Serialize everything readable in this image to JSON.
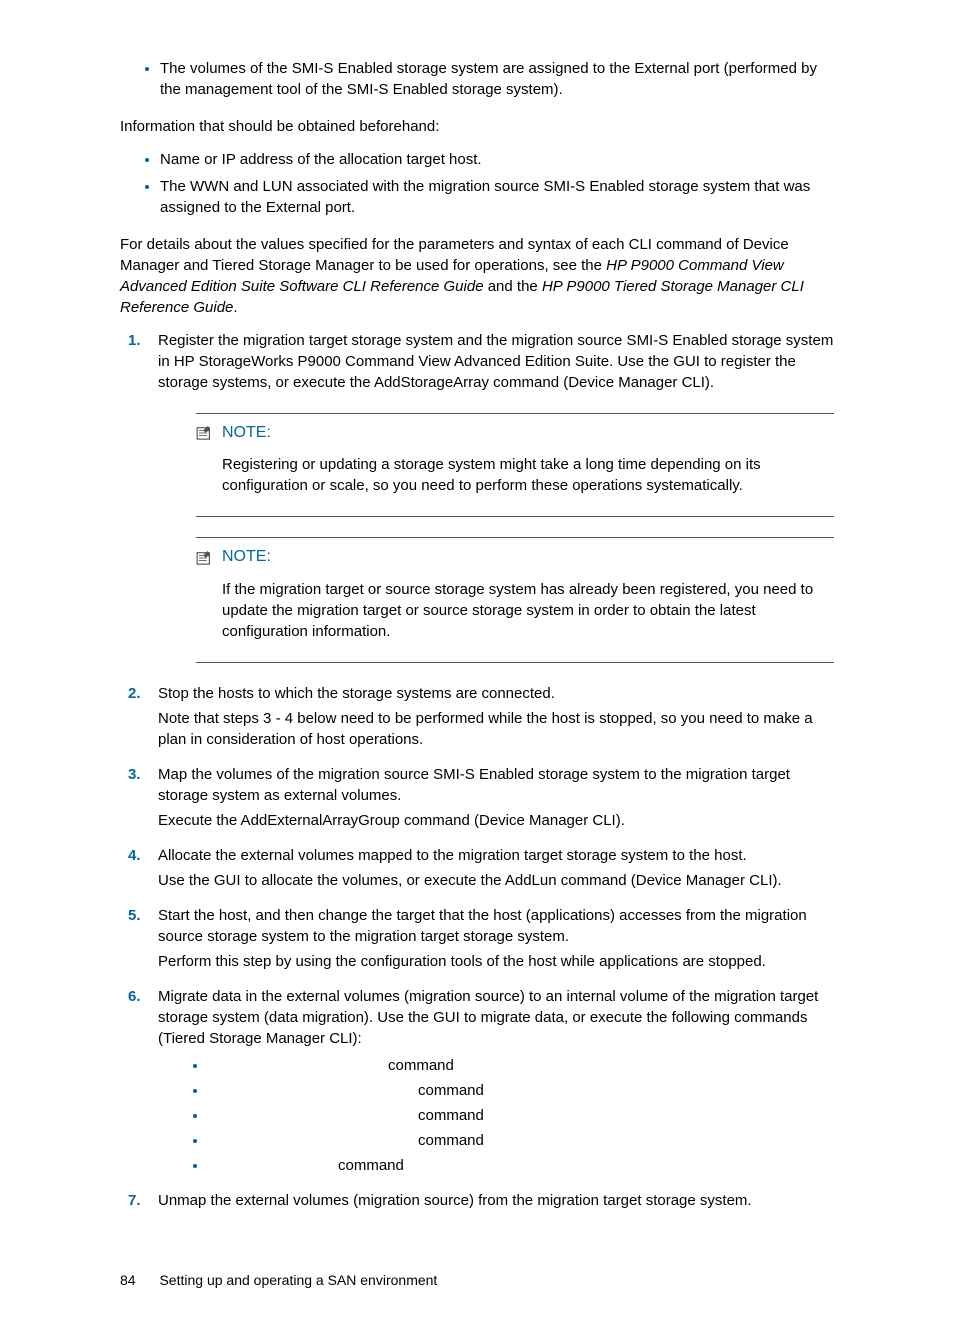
{
  "top_bullets": [
    "The volumes of the SMI-S Enabled storage system are assigned to the External port (performed by the management tool of the SMI-S Enabled storage system)."
  ],
  "info_intro": "Information that should be obtained beforehand:",
  "info_bullets": [
    "Name or IP address of the allocation target host.",
    "The WWN and LUN associated with the migration source SMI-S Enabled storage system that was assigned to the External port."
  ],
  "details_para_1": "For details about the values specified for the parameters and syntax of each CLI command of Device Manager and Tiered Storage Manager to be used for operations, see the ",
  "details_italic_1": "HP P9000 Command View Advanced Edition Suite Software CLI Reference Guide",
  "details_para_2": " and the ",
  "details_italic_2": "HP P9000 Tiered Storage Manager CLI Reference Guide",
  "details_para_3": ".",
  "steps": {
    "1": {
      "num": "1.",
      "text": "Register the migration target storage system and the migration source SMI-S Enabled storage system in HP StorageWorks P9000 Command View Advanced Edition Suite. Use the GUI to register the storage systems, or execute the AddStorageArray command (Device Manager CLI)."
    },
    "2": {
      "num": "2.",
      "text": "Stop the hosts to which the storage systems are connected.",
      "extra": "Note that steps 3 - 4 below need to be performed while the host is stopped, so you need to make a plan in consideration of host operations."
    },
    "3": {
      "num": "3.",
      "text": "Map the volumes of the migration source SMI-S Enabled storage system to the migration target storage system as external volumes.",
      "extra": "Execute the AddExternalArrayGroup command (Device Manager CLI)."
    },
    "4": {
      "num": "4.",
      "text": "Allocate the external volumes mapped to the migration target storage system to the host.",
      "extra": "Use the GUI to allocate the volumes, or execute the AddLun command (Device Manager CLI)."
    },
    "5": {
      "num": "5.",
      "text": "Start the host, and then change the target that the host (applications) accesses from the migration source storage system to the migration target storage system.",
      "extra": "Perform this step by using the configuration tools of the host while applications are stopped."
    },
    "6": {
      "num": "6.",
      "text": "Migrate data in the external volumes (migration source) to an internal volume of the migration target storage system (data migration). Use the GUI to migrate data, or execute the following commands (Tiered Storage Manager CLI):"
    },
    "7": {
      "num": "7.",
      "text": "Unmap the external volumes (migration source) from the migration target storage system."
    }
  },
  "note1_label": "NOTE:",
  "note1_body": "Registering or updating a storage system might take a long time depending on its configuration or scale, so you need to perform these operations systematically.",
  "note2_label": "NOTE:",
  "note2_body": "If the migration target or source storage system has already been registered, you need to update the migration target or source storage system in order to obtain the latest configuration information.",
  "cmd_word": "command",
  "cmd_padding": [
    "180px",
    "210px",
    "210px",
    "210px",
    "130px"
  ],
  "footer_page": "84",
  "footer_title": "Setting up and operating a SAN environment"
}
